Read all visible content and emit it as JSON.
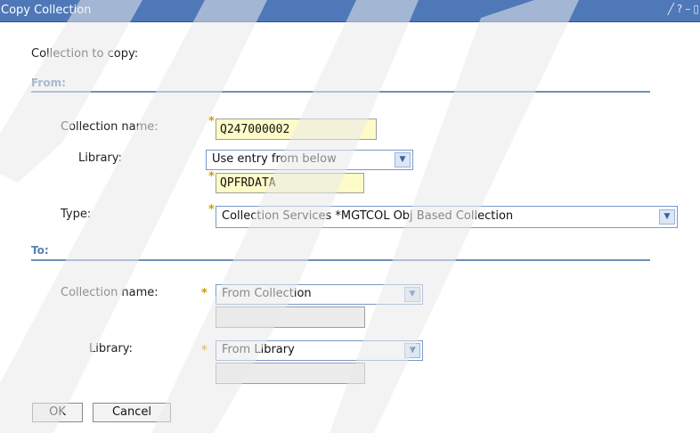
{
  "window": {
    "title": "Copy Collection",
    "icons": [
      "pencil-icon",
      "help-icon",
      "minimize-icon",
      "restore-icon"
    ],
    "icon_glyphs": [
      "╱",
      "?",
      "–",
      "▯"
    ]
  },
  "intro": "Collection to copy:",
  "from": {
    "heading": "From:",
    "collection_name_label": "Collection name:",
    "collection_name_value": "Q247000002",
    "library_label": "Library:",
    "library_select": "Use entry from below",
    "library_value": "QPFRDATA",
    "type_label": "Type:",
    "type_select": "Collection Services *MGTCOL Obj Based Collection"
  },
  "to": {
    "heading": "To:",
    "collection_name_label": "Collection name:",
    "collection_name_select": "From Collection",
    "collection_name_value": "",
    "library_label": "Library:",
    "library_select": "From Library",
    "library_value": ""
  },
  "buttons": {
    "ok": "OK",
    "cancel": "Cancel"
  },
  "required_marker": "*",
  "dropdown_glyph": "▼",
  "colors": {
    "titlebar": "#4f78b8",
    "section_heading": "#5b7fae",
    "required_marker": "#c8a000",
    "input_fill": "#fdfbc8"
  }
}
